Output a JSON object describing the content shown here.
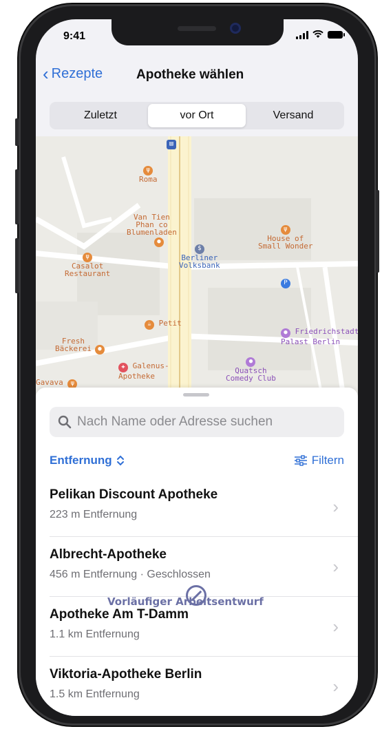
{
  "status_bar": {
    "time": "9:41"
  },
  "nav": {
    "back_label": "Rezepte",
    "title": "Apotheke wählen"
  },
  "segments": [
    {
      "label": "Zuletzt",
      "active": false
    },
    {
      "label": "vor Ort",
      "active": true
    },
    {
      "label": "Versand",
      "active": false
    }
  ],
  "map": {
    "pois": [
      {
        "label": "Roma"
      },
      {
        "label": "Van Tien\nPhan co\nBlumenladen"
      },
      {
        "label": "House of\nSmall Wonder"
      },
      {
        "label": "Casalot\nRestaurant"
      },
      {
        "label": "Berliner\nVolksbank"
      },
      {
        "label": "Petit"
      },
      {
        "label": "Friedrichstadt\nPalast Berlin"
      },
      {
        "label": "Fresh\nBäckerei"
      },
      {
        "label": "Galenus-\nApotheke"
      },
      {
        "label": "Quatsch\nComedy Club"
      },
      {
        "label": "Gavava"
      }
    ]
  },
  "search": {
    "placeholder": "Nach Name oder Adresse suchen"
  },
  "sort": {
    "label": "Entfernung"
  },
  "filter": {
    "label": "Filtern"
  },
  "pharmacies": [
    {
      "name": "Pelikan Discount Apotheke",
      "detail": "223 m Entfernung"
    },
    {
      "name": "Albrecht-Apotheke",
      "detail": "456 m Entfernung · Geschlossen"
    },
    {
      "name": "Apotheke Am T-Damm",
      "detail": "1.1 km Entfernung"
    },
    {
      "name": "Viktoria-Apotheke Berlin",
      "detail": "1.5 km Entfernung"
    }
  ],
  "watermark": {
    "text": "Vorläufiger Arbeitsentwurf"
  },
  "colors": {
    "accent": "#2f6fd6",
    "poi_orange": "#c46a34",
    "poi_purple": "#8b51b8"
  }
}
